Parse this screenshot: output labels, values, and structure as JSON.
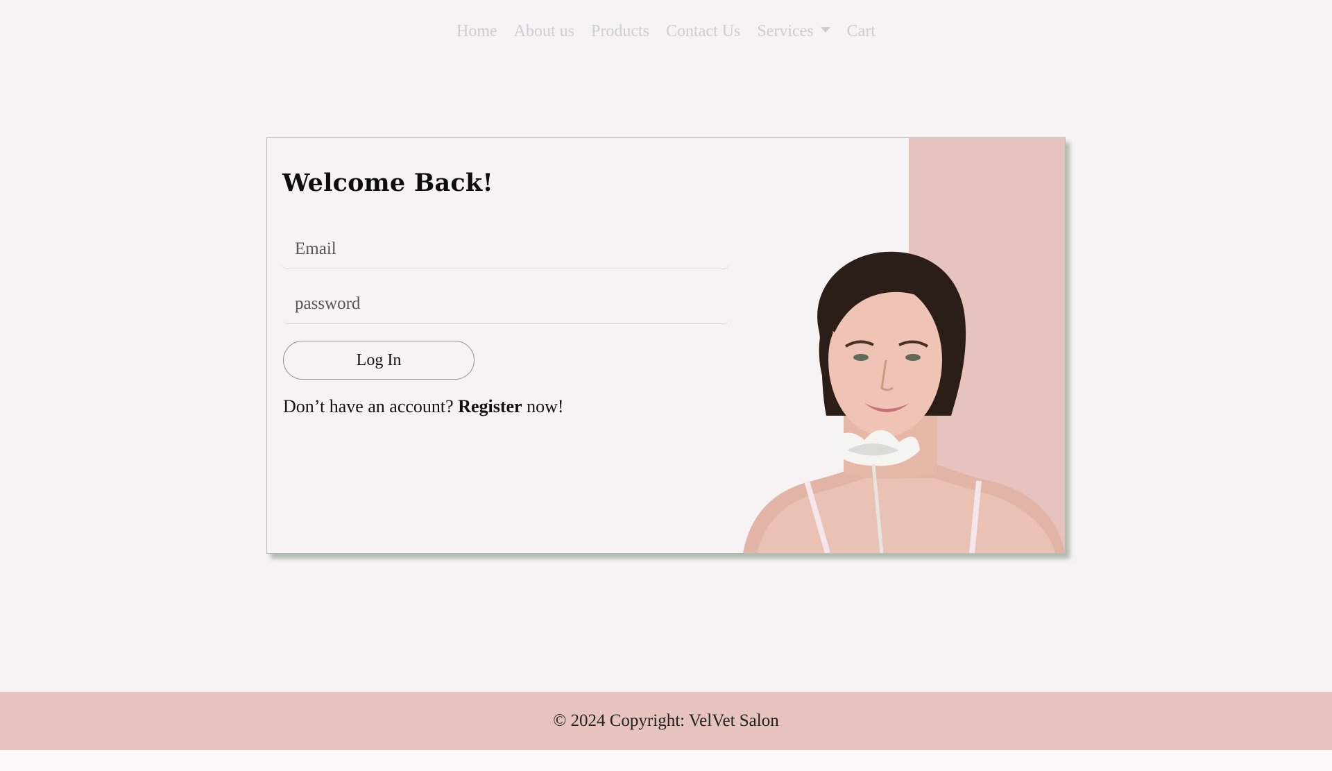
{
  "nav": {
    "items": [
      {
        "label": "Home"
      },
      {
        "label": "About us"
      },
      {
        "label": "Products"
      },
      {
        "label": "Contact Us"
      },
      {
        "label": "Services",
        "has_dropdown": true
      },
      {
        "label": "Cart"
      }
    ]
  },
  "login": {
    "title": "Welcome Back!",
    "email_placeholder": "Email",
    "password_placeholder": "password",
    "login_label": "Log In",
    "register_prefix": "Don’t have an account?",
    "register_link": "Register",
    "register_suffix": "now!"
  },
  "footer": {
    "text": "© 2024 Copyright: VelVet Salon"
  },
  "colors": {
    "page_bg": "#f7f3f5",
    "accent_pink": "#e6c3bf",
    "nav_text": "#c9cfcf",
    "card_shadow": "#96aa96"
  }
}
